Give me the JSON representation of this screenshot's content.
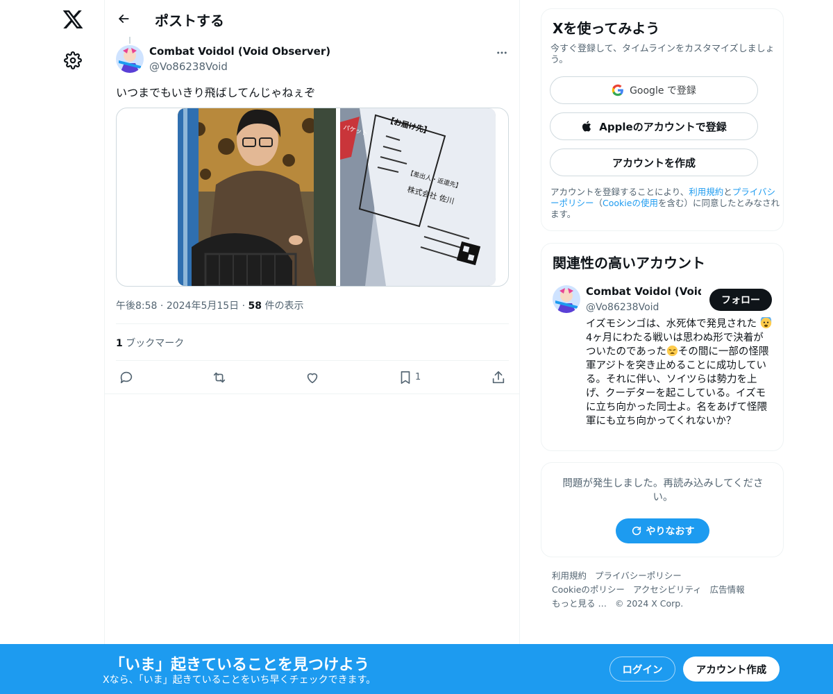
{
  "colors": {
    "accent": "#1d9bf0",
    "text": "#0f1419",
    "muted": "#536471",
    "border": "#eff3f4"
  },
  "nav": {
    "logo": "x-logo-icon",
    "settings": "gear-icon"
  },
  "header": {
    "title": "ポストする",
    "back_icon": "arrow-left-icon"
  },
  "post": {
    "author_name": "Combat Voidol (Void Observer)",
    "author_handle": "@Vo86238Void",
    "text": "いつまでもいきり飛ばしてんじゃねぇぞ",
    "time": "午後8:58",
    "date": "2024年5月15日",
    "views_count": "58",
    "views_label": " 件の表示",
    "bookmarks_count": "1",
    "bookmarks_label": " ブックマーク",
    "action_bookmark_count": "1",
    "image_text": {
      "deliver_to": "【お届け先】",
      "sender_title": "【差出人・返還先】",
      "company": "株式会社 佐川",
      "packet": "パケット"
    }
  },
  "signup": {
    "title": "Xを使ってみよう",
    "subtitle": "今すぐ登録して、タイムラインをカスタマイズしましょう。",
    "google_label": "Google で登録",
    "apple_label": "Appleのアカウントで登録",
    "create_label": "アカウントを作成",
    "terms_1": "アカウントを登録することにより、",
    "terms_link1": "利用規約",
    "terms_2": "と",
    "terms_link2": "プライバシーポリシー",
    "terms_3": "（",
    "terms_link3": "Cookieの使用",
    "terms_4": "を含む）に同意したとみなされます。"
  },
  "relevant": {
    "title": "関連性の高いアカウント",
    "name": "Combat Voidol (Void Observer)",
    "handle": "@Vo86238Void",
    "follow_label": "フォロー",
    "bio_1": "イズモシンゴは、水死体で発見された",
    "bio_2": "4ヶ月にわたる戦いは思わぬ形で決着がついたのであった",
    "bio_3": "その間に一部の怪隈軍アジトを突き止めることに成功している。それに伴い、ソイツらは勢力を上げ、クーデターを起こしている。イズモに立ち向かった同士よ。名をあげて怪隈軍にも立ち向かってくれないか？"
  },
  "error": {
    "text": "問題が発生しました。再読み込みしてください。",
    "retry_label": "やりなおす"
  },
  "footer": {
    "terms": "利用規約",
    "privacy": "プライバシーポリシー",
    "cookie": "Cookieのポリシー",
    "accessibility": "アクセシビリティ",
    "ads": "広告情報",
    "more": "もっと見る …",
    "copyright": "© 2024 X Corp."
  },
  "bottom_bar": {
    "title": "「いま」起きていることを見つけよう",
    "subtitle": "Xなら、「いま」起きていることをいち早くチェックできます。",
    "login_label": "ログイン",
    "signup_label": "アカウント作成"
  }
}
